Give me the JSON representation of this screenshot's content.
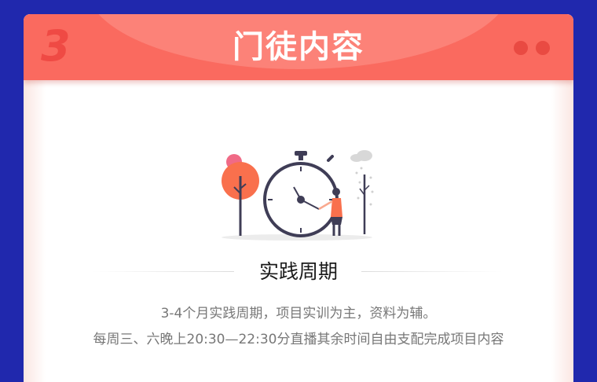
{
  "header": {
    "number": "3",
    "title": "门徒内容"
  },
  "section": {
    "title": "实践周期",
    "description_line_1": "3-4个月实践周期，项目实训为主，资料为辅。",
    "description_line_2": "每周三、六晚上20:30—22:30分直播其余时间自由支配完成项目内容"
  },
  "colors": {
    "page_background": "#2028ad",
    "header_red": "#fa6a5f",
    "header_accent": "#ef4a44",
    "tree_orange": "#f9704d",
    "clock_dark": "#3f3d56"
  },
  "illustration": {
    "icon": "stopwatch-person-trees-icon"
  }
}
